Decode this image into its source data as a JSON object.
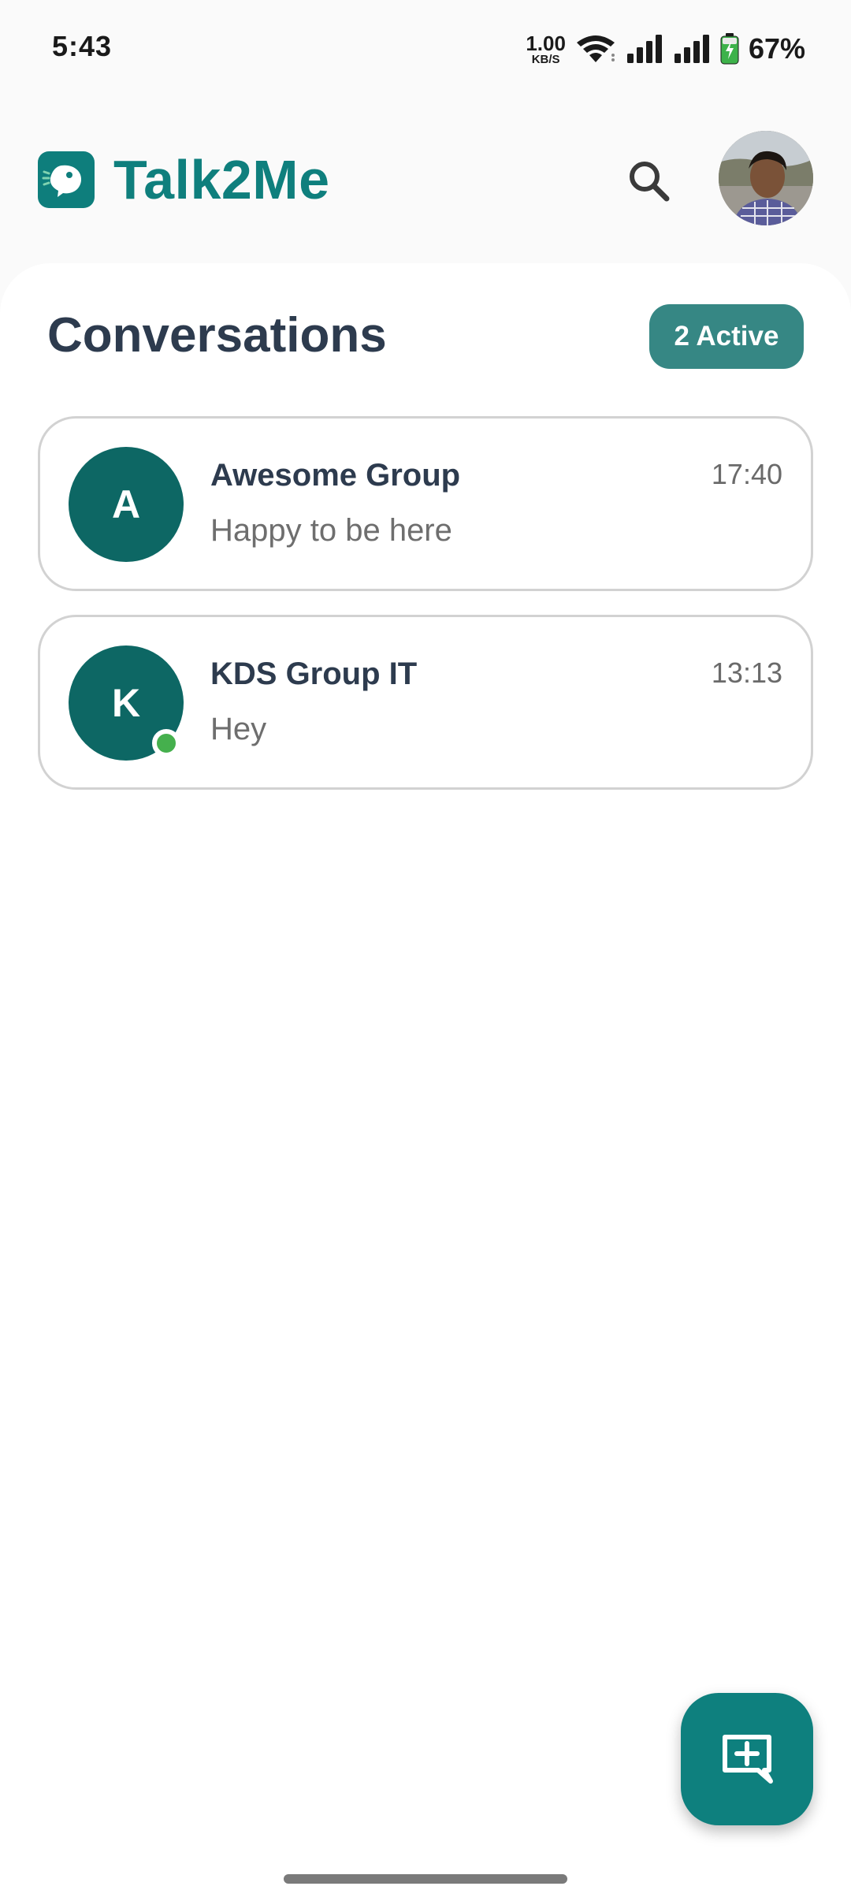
{
  "status_bar": {
    "time": "5:43",
    "net_speed_value": "1.00",
    "net_speed_unit": "KB/S",
    "battery_percent": "67%",
    "icons": [
      "wifi-icon",
      "signal-icon",
      "signal-icon",
      "battery-charging-icon"
    ]
  },
  "header": {
    "app_name": "Talk2Me",
    "logo_icon": "chat-bubble-logo-icon",
    "search_icon": "search-icon",
    "avatar": "user-profile-photo"
  },
  "conversations": {
    "title": "Conversations",
    "active_badge": "2 Active",
    "items": [
      {
        "initial": "A",
        "name": "Awesome Group",
        "time": "17:40",
        "preview": "Happy to be here",
        "online": false
      },
      {
        "initial": "K",
        "name": "KDS Group IT",
        "time": "13:13",
        "preview": "Hey",
        "online": true
      }
    ]
  },
  "fab": {
    "icon": "new-chat-icon"
  },
  "colors": {
    "brand": "#0f7f7d",
    "avatar_bg": "#0d6764",
    "badge_bg": "#368784",
    "online": "#45b04d",
    "text_dark": "#2d3b4e"
  }
}
